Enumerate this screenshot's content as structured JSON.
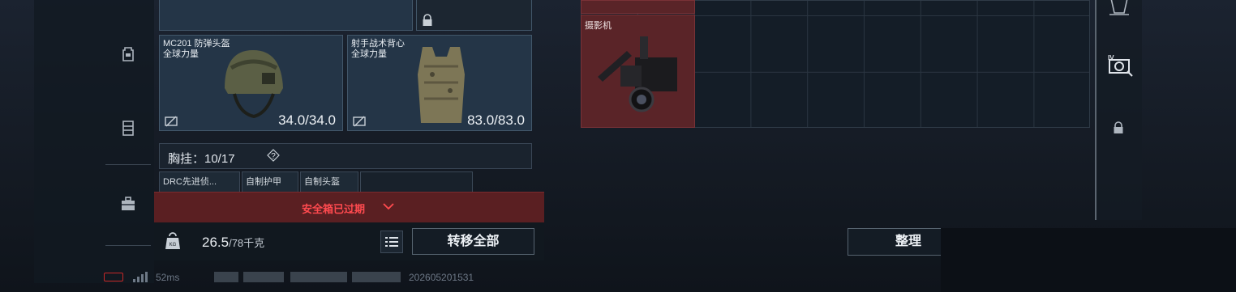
{
  "slots": {
    "helmet": {
      "name_line1": "MC201 防弹头盔",
      "name_line2": "全球力量",
      "durability": "34.0/34.0"
    },
    "vest": {
      "name_line1": "射手战术背心",
      "name_line2": "全球力量",
      "durability": "83.0/83.0"
    }
  },
  "chest_rig": {
    "label": "胸挂：10/17",
    "help": "?"
  },
  "mini_items": [
    "DRC先进侦...",
    "自制护甲",
    "自制头盔",
    ""
  ],
  "safe_box": {
    "status": "安全箱已过期"
  },
  "weight": {
    "current": "26.5",
    "max": "/78千克"
  },
  "buttons": {
    "transfer_all": "转移全部",
    "sort": "整理"
  },
  "grid_item": {
    "name": "摄影机"
  },
  "status_bar": {
    "ping": "52ms",
    "stamp": "202605201531"
  },
  "colors": {
    "accent_red": "#ff4a4f",
    "banner_bg": "#5a1f22",
    "slot_bg": "#243547",
    "camera_bg": "#5a2428"
  },
  "icons": [
    "backpack-icon",
    "pouch-icon",
    "toolbox-icon",
    "lock-icon",
    "no-insure-icon",
    "weight-icon",
    "list-icon",
    "chevron-down-icon",
    "armor-repair-icon"
  ]
}
